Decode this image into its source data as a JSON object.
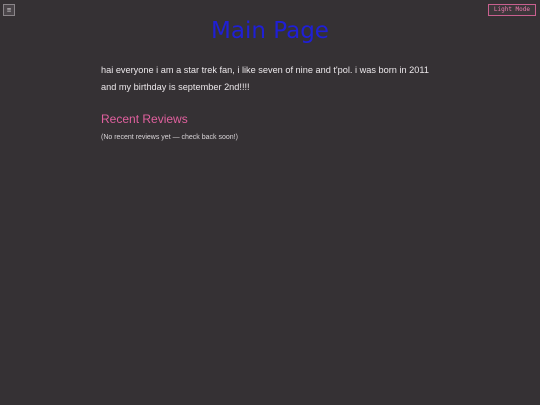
{
  "header": {
    "menu_icon": "menu-icon",
    "menu_glyph": "≡",
    "theme_toggle_label": "Light Mode",
    "title": "Main Page"
  },
  "main": {
    "intro": "hai everyone i am a star trek fan, i like seven of nine and t'pol. i was born in 2011 and my birthday is september 2nd!!!!",
    "reviews": {
      "heading": "Recent Reviews",
      "empty_message": "(No recent reviews yet — check back soon!)"
    }
  },
  "colors": {
    "background": "#353134",
    "title": "#1f1fd6",
    "accent": "#e0609e",
    "text": "#ebe7ea"
  }
}
